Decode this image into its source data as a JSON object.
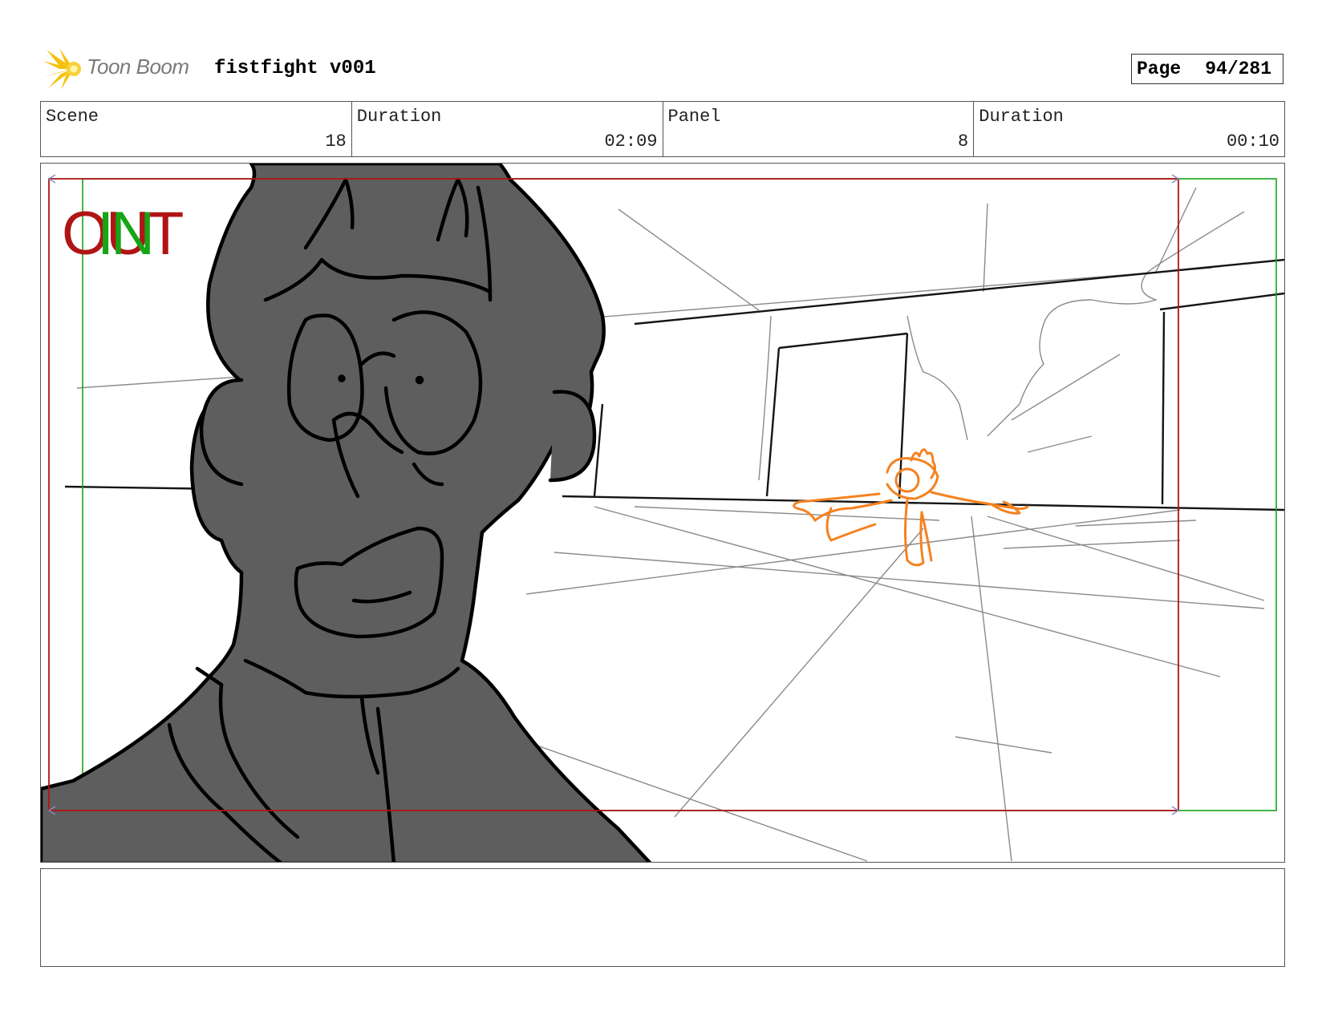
{
  "header": {
    "logo_text": "Toon Boom",
    "project_title": "fistfight v001",
    "page_label": "Page",
    "page_number": "94/281"
  },
  "info": {
    "scene_label": "Scene",
    "scene_value": "18",
    "scene_duration_label": "Duration",
    "scene_duration_value": "02:09",
    "panel_label": "Panel",
    "panel_value": "8",
    "panel_duration_label": "Duration",
    "panel_duration_value": "00:10"
  },
  "panel": {
    "safe_out_label": "OUT",
    "safe_in_label": "IN",
    "colors": {
      "out_frame": "#b01515",
      "in_frame": "#16a516",
      "character_fill": "#5e5e5e",
      "sketch_orange": "#f5821f"
    }
  },
  "notes": {
    "text": ""
  }
}
